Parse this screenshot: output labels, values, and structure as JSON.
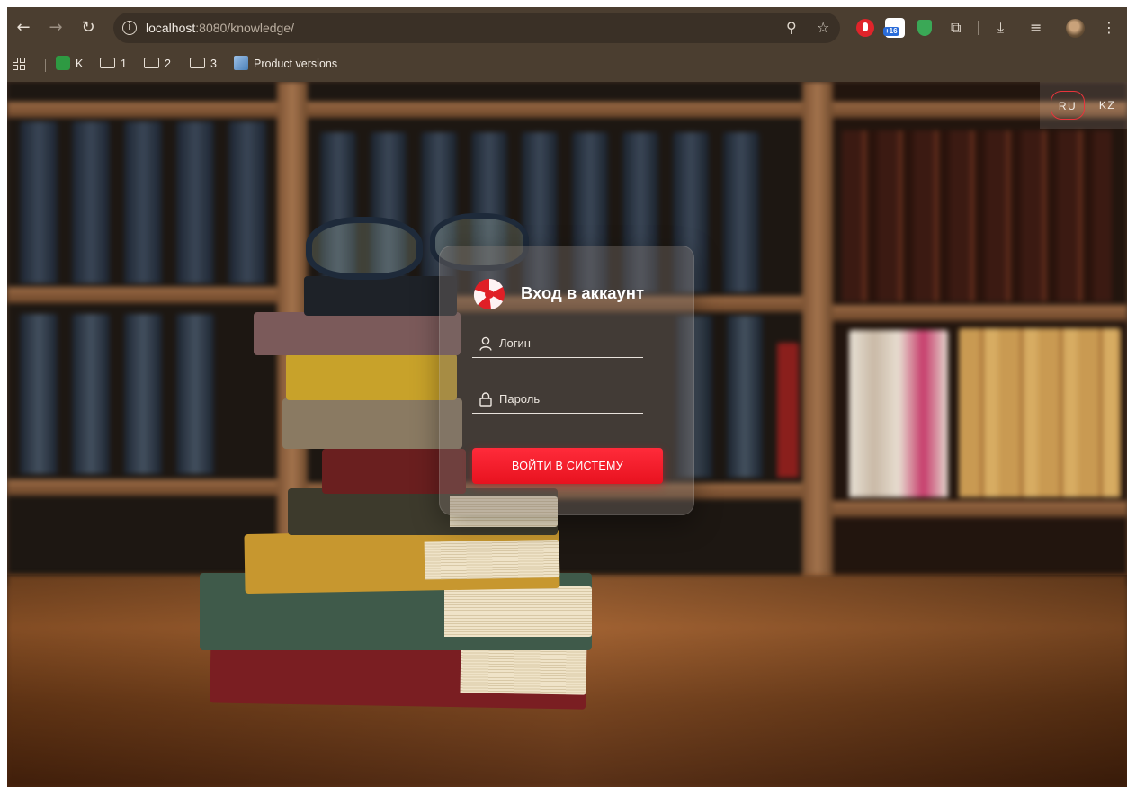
{
  "browser": {
    "url_host": "localhost",
    "url_rest": ":8080/knowledge/",
    "extension_badge": "+16",
    "bookmarks": [
      {
        "label": "K",
        "icon": "k-favicon"
      },
      {
        "label": "1",
        "icon": "folder-icon"
      },
      {
        "label": "2",
        "icon": "folder-icon"
      },
      {
        "label": "3",
        "icon": "folder-icon"
      },
      {
        "label": "Product versions",
        "icon": "product-versions-favicon"
      }
    ]
  },
  "language": {
    "options": [
      "RU",
      "KZ"
    ],
    "selected": "RU",
    "accent": "#e8343c"
  },
  "login": {
    "title": "Вход в аккаунт",
    "login_placeholder": "Логин",
    "password_placeholder": "Пароль",
    "submit_label": "ВОЙТИ В СИСТЕМУ",
    "button_color": "#ff1f2e"
  }
}
